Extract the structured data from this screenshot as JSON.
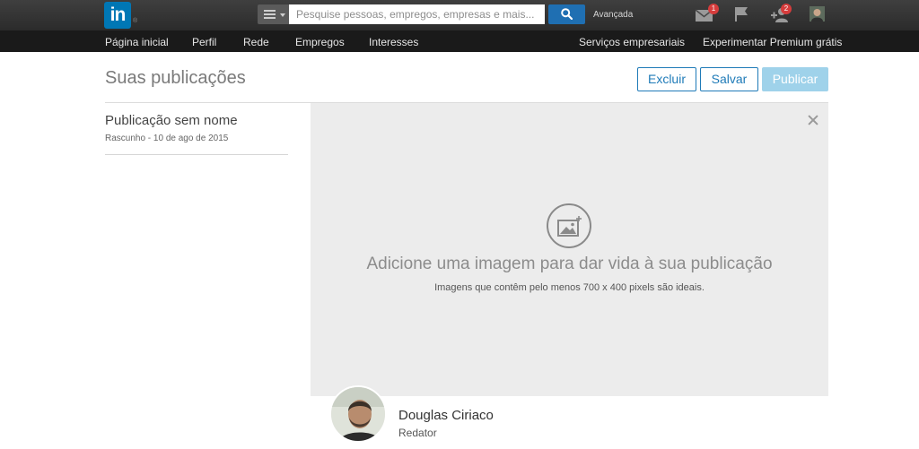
{
  "topbar": {
    "logo_text": "in",
    "logo_mark": "®",
    "search_placeholder": "Pesquise pessoas, empregos, empresas e mais...",
    "advanced_label": "Avançada",
    "icons": {
      "menu": "menu-icon",
      "search": "search-icon",
      "messages": "envelope-icon",
      "flag": "flag-icon",
      "connections": "add-connection-icon",
      "profile": "avatar"
    },
    "messages_badge": "1",
    "connections_badge": "2"
  },
  "subnav": {
    "items": [
      {
        "label": "Página inicial"
      },
      {
        "label": "Perfil"
      },
      {
        "label": "Rede"
      },
      {
        "label": "Empregos"
      },
      {
        "label": "Interesses"
      }
    ],
    "business_services": "Serviços empresariais",
    "premium": "Experimentar Premium grátis"
  },
  "main": {
    "page_title": "Suas publicações",
    "buttons": {
      "delete": "Excluir",
      "save": "Salvar",
      "publish": "Publicar"
    },
    "draft": {
      "title": "Publicação sem nome",
      "meta": "Rascunho - 10 de ago de 2015"
    },
    "image_panel": {
      "title": "Adicione uma imagem para dar vida à sua publicação",
      "subtitle": "Imagens que contêm pelo menos 700 x 400 pixels são ideais."
    },
    "author": {
      "name": "Douglas Ciriaco",
      "role": "Redator"
    }
  },
  "colors": {
    "brand": "#0077b5",
    "accent": "#1f7bb8",
    "publish_disabled": "#9fd2ea",
    "topbar": "#2b2b2b",
    "badge": "#d63c3c"
  }
}
